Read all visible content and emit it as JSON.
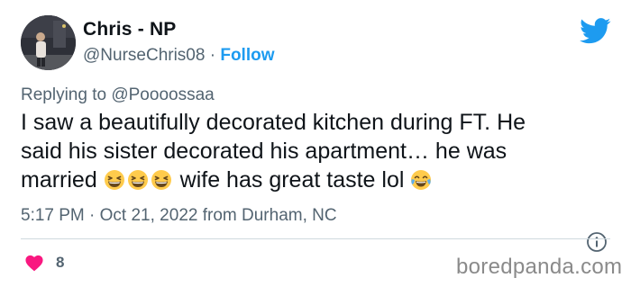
{
  "user": {
    "name": "Chris - NP",
    "handle": "@NurseChris08",
    "separator": "·",
    "follow_label": "Follow"
  },
  "reply": {
    "prefix": "Replying to",
    "handle": "@Poooossaa"
  },
  "tweet": {
    "line1": "I saw a beautifully decorated kitchen during FT. He",
    "line2": "said his sister decorated his apartment… he was",
    "line3_start": "married",
    "line3_mid": "wife has great taste lol",
    "emojis": [
      "grinning-squinting-face",
      "grinning-squinting-face",
      "grinning-squinting-face",
      "face-with-tears-of-joy"
    ]
  },
  "meta": {
    "time": "5:17 PM",
    "separator": "·",
    "date": "Oct 21, 2022",
    "location_prefix": "from",
    "location": "Durham, NC"
  },
  "engagement": {
    "likes": "8",
    "like_icon": "heart-icon"
  },
  "icons": {
    "twitter": "twitter-bird-icon",
    "info": "info-icon"
  },
  "watermark": "boredpanda.com",
  "colors": {
    "accent": "#1d9bf0",
    "heart": "#f91880",
    "muted": "#536471",
    "text": "#0f1419"
  }
}
